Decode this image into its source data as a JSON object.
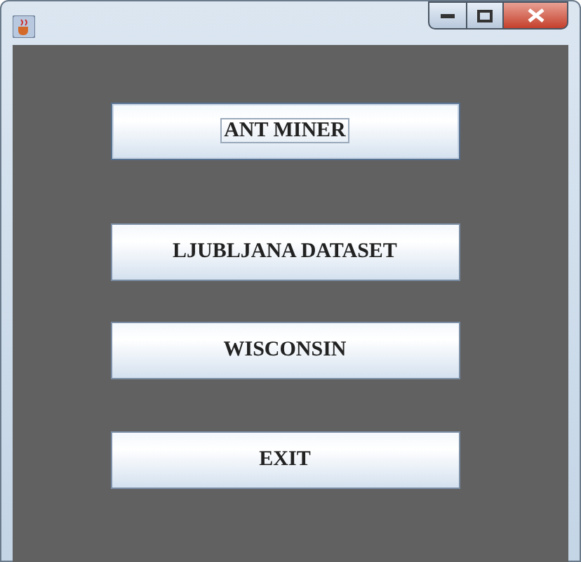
{
  "buttons": [
    {
      "label": "ANT MINER",
      "focused": true
    },
    {
      "label": "LJUBLJANA DATASET",
      "focused": false
    },
    {
      "label": "WISCONSIN",
      "focused": false
    },
    {
      "label": "EXIT",
      "focused": false
    }
  ]
}
